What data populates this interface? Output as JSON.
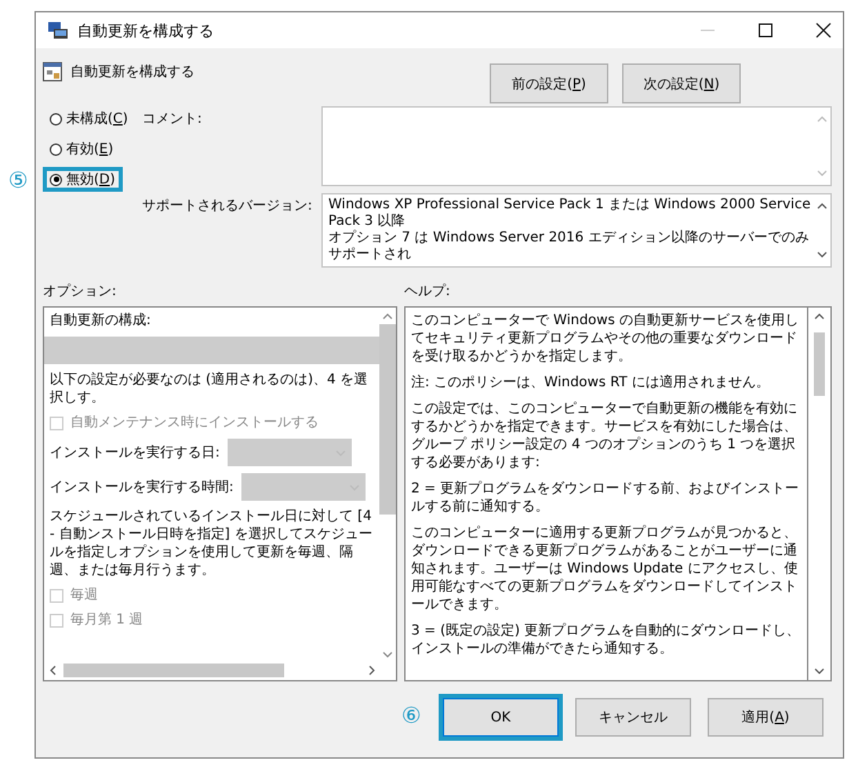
{
  "window": {
    "title": "自動更新を構成する"
  },
  "setting_name": "自動更新を構成する",
  "nav_buttons": [
    {
      "before": "前の設定(",
      "key": "P",
      "after": ")"
    },
    {
      "before": "次の設定(",
      "key": "N",
      "after": ")"
    }
  ],
  "radios": [
    {
      "before": "未構成(",
      "key": "C",
      "after": ")",
      "selected": false,
      "highlighted": false
    },
    {
      "before": "有効(",
      "key": "E",
      "after": ")",
      "selected": false,
      "highlighted": false
    },
    {
      "before": "無効(",
      "key": "D",
      "after": ")",
      "selected": true,
      "highlighted": true,
      "callout": "⑤"
    }
  ],
  "comment": {
    "label": "コメント:"
  },
  "supported": {
    "label": "サポートされるバージョン:",
    "lines": [
      "Windows XP Professional Service Pack 1 または Windows 2000 Service Pack 3 以降",
      "オプション 7 は Windows Server 2016 エディション以降のサーバーでのみサポートされ"
    ]
  },
  "options": {
    "label": "オプション:",
    "items": [
      {
        "kind": "text",
        "text": "自動更新の構成:",
        "disabled": false
      },
      {
        "kind": "dropdown",
        "disabled": true
      },
      {
        "kind": "text",
        "text": "以下の設定が必要なのは (適用されるのは)、4 を選択しす。",
        "disabled": false
      },
      {
        "kind": "checkbox",
        "text": "自動メンテナンス時にインストールする",
        "checked": false,
        "disabled": true
      },
      {
        "kind": "labeled-dropdown",
        "text": "インストールを実行する日:",
        "disabled": true
      },
      {
        "kind": "labeled-dropdown",
        "text": "インストールを実行する時間:",
        "disabled": true
      },
      {
        "kind": "text",
        "text": "スケジュールされているインストール日に対して [4 - 自動ンストール日時を指定] を選択してスケジュールを指定しオプションを使用して更新を毎週、隔週、または毎月行うます。",
        "disabled": false
      },
      {
        "kind": "checkbox",
        "text": "毎週",
        "checked": false,
        "disabled": true
      },
      {
        "kind": "checkbox",
        "text": "毎月第 1 週",
        "checked": false,
        "disabled": true
      }
    ]
  },
  "help": {
    "label": "ヘルプ:",
    "paragraphs": [
      "このコンピューターで Windows の自動更新サービスを使用してセキュリティ更新プログラムやその他の重要なダウンロードを受け取るかどうかを指定します。",
      "注: このポリシーは、Windows RT には適用されません。",
      "この設定では、このコンピューターで自動更新の機能を有効にするかどうかを指定できます。サービスを有効にした場合は、グループ ポリシー設定の 4 つのオプションのうち 1 つを選択する必要があります:",
      " 2 = 更新プログラムをダウンロードする前、およびインストールする前に通知する。",
      " このコンピューターに適用する更新プログラムが見つかると、ダウンロードできる更新プログラムがあることがユーザーに通知されます。ユーザーは Windows Update にアクセスし、使用可能なすべての更新プログラムをダウンロードしてインストールできます。",
      " 3 = (既定の設定) 更新プログラムを自動的にダウンロードし、インストールの準備ができたら通知する。"
    ]
  },
  "buttons": [
    {
      "kind": "ok",
      "before": "OK",
      "highlighted": true,
      "callout": "⑥"
    },
    {
      "kind": "cancel",
      "before": "キャンセル",
      "highlighted": false
    },
    {
      "kind": "apply",
      "before": "適用(",
      "key": "A",
      "after": ")",
      "highlighted": false
    }
  ]
}
